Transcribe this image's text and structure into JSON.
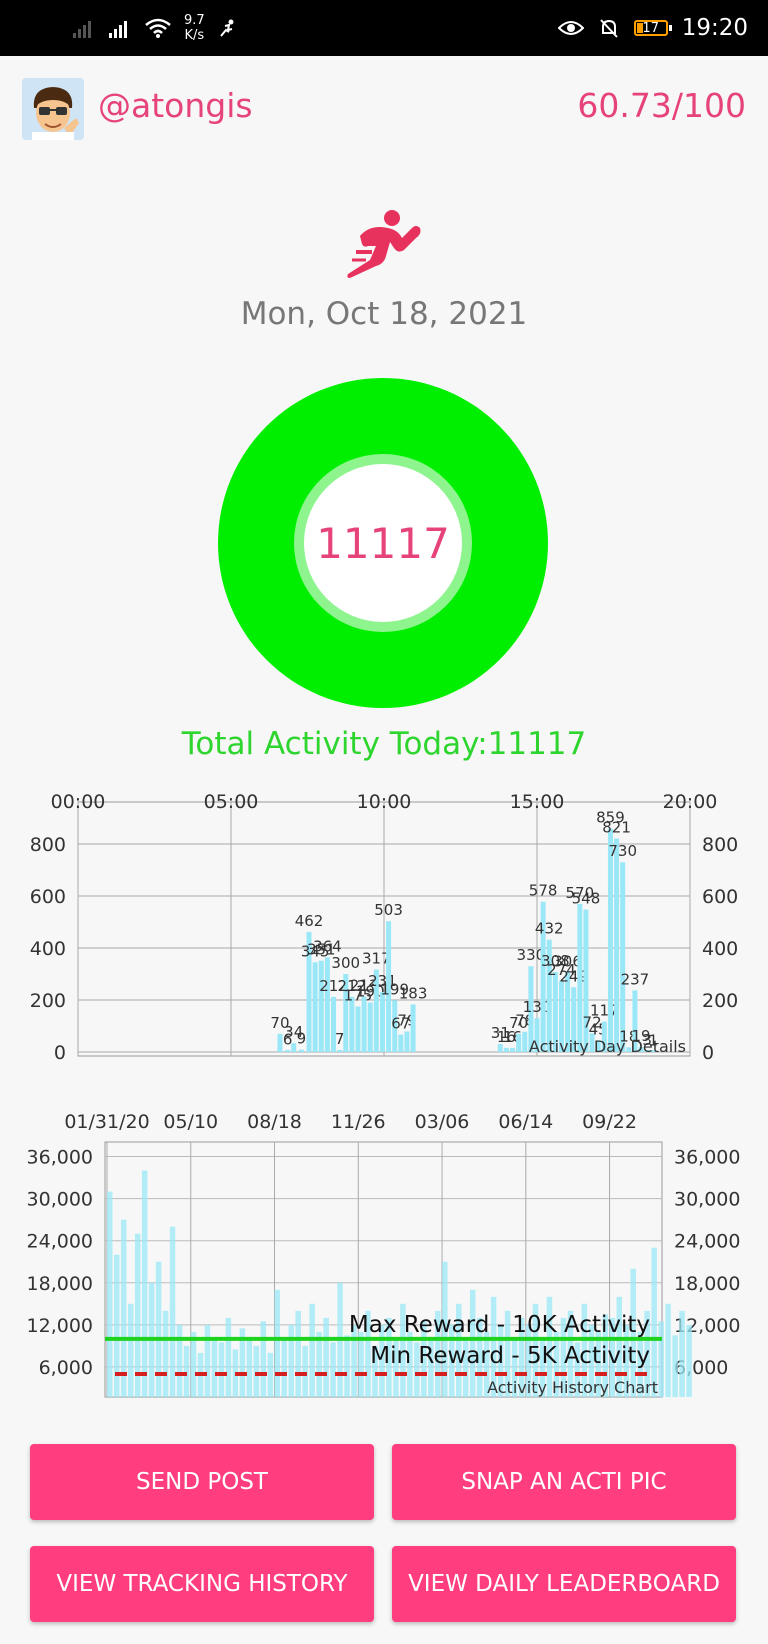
{
  "status_bar": {
    "speed_value": "9.7",
    "speed_unit": "K/s",
    "battery": "17",
    "time": "19:20"
  },
  "header": {
    "username": "@atongis",
    "score": "60.73/100"
  },
  "date": "Mon, Oct 18, 2021",
  "ring": {
    "value": "11117",
    "color": "#00ef00"
  },
  "total_activity": "Total Activity Today:11117",
  "chart_data": [
    {
      "type": "bar",
      "caption": "Activity Day Details",
      "x_ticks": [
        "00:00",
        "05:00",
        "10:00",
        "15:00",
        "20:00"
      ],
      "x_range_hours": [
        0,
        24
      ],
      "ylim": [
        0,
        900
      ],
      "y_ticks": [
        "0",
        "200",
        "400",
        "600",
        "800"
      ],
      "bar_color": "#9ae8f7",
      "bars": [
        {
          "t": 6.6,
          "v": 70,
          "label": "70"
        },
        {
          "t": 6.85,
          "v": 6,
          "label": "6"
        },
        {
          "t": 7.05,
          "v": 34,
          "label": "34"
        },
        {
          "t": 7.3,
          "v": 9,
          "label": "9"
        },
        {
          "t": 7.55,
          "v": 462,
          "label": "462"
        },
        {
          "t": 7.75,
          "v": 345,
          "label": "345"
        },
        {
          "t": 7.95,
          "v": 351,
          "label": "351"
        },
        {
          "t": 8.15,
          "v": 364,
          "label": "364"
        },
        {
          "t": 8.35,
          "v": 212,
          "label": "212"
        },
        {
          "t": 8.55,
          "v": 7,
          "label": "7"
        },
        {
          "t": 8.75,
          "v": 300,
          "label": "300"
        },
        {
          "t": 8.95,
          "v": 212,
          "label": "212"
        },
        {
          "t": 9.15,
          "v": 175,
          "label": "175"
        },
        {
          "t": 9.35,
          "v": 213,
          "label": "213"
        },
        {
          "t": 9.55,
          "v": 190,
          "label": "190"
        },
        {
          "t": 9.75,
          "v": 317,
          "label": "317"
        },
        {
          "t": 9.95,
          "v": 231,
          "label": "231"
        },
        {
          "t": 10.15,
          "v": 503,
          "label": "503"
        },
        {
          "t": 10.35,
          "v": 199,
          "label": "199"
        },
        {
          "t": 10.55,
          "v": 67,
          "label": "67"
        },
        {
          "t": 10.75,
          "v": 79,
          "label": "79"
        },
        {
          "t": 10.95,
          "v": 183,
          "label": "183"
        },
        {
          "t": 13.8,
          "v": 31,
          "label": "31"
        },
        {
          "t": 14.0,
          "v": 16,
          "label": "16"
        },
        {
          "t": 14.2,
          "v": 16,
          "label": "16"
        },
        {
          "t": 14.4,
          "v": 70,
          "label": "70"
        },
        {
          "t": 14.6,
          "v": 78,
          "label": "78"
        },
        {
          "t": 14.8,
          "v": 330,
          "label": "330"
        },
        {
          "t": 15.0,
          "v": 130,
          "label": "130"
        },
        {
          "t": 15.2,
          "v": 578,
          "label": "578"
        },
        {
          "t": 15.4,
          "v": 432,
          "label": "432"
        },
        {
          "t": 15.6,
          "v": 308,
          "label": "308"
        },
        {
          "t": 15.8,
          "v": 274,
          "label": "274"
        },
        {
          "t": 16.0,
          "v": 306,
          "label": "306"
        },
        {
          "t": 16.2,
          "v": 249,
          "label": "249"
        },
        {
          "t": 16.4,
          "v": 570,
          "label": "570"
        },
        {
          "t": 16.6,
          "v": 548,
          "label": "548"
        },
        {
          "t": 16.8,
          "v": 72,
          "label": "72"
        },
        {
          "t": 17.0,
          "v": 45,
          "label": "45"
        },
        {
          "t": 17.2,
          "v": 117,
          "label": "117"
        },
        {
          "t": 17.4,
          "v": 859,
          "label": "859"
        },
        {
          "t": 17.6,
          "v": 821,
          "label": "821"
        },
        {
          "t": 17.8,
          "v": 730,
          "label": "730"
        },
        {
          "t": 18.0,
          "v": 18,
          "label": "18"
        },
        {
          "t": 18.2,
          "v": 237,
          "label": "237"
        },
        {
          "t": 18.4,
          "v": 19,
          "label": "19"
        },
        {
          "t": 18.6,
          "v": 3,
          "label": "3"
        },
        {
          "t": 18.8,
          "v": 1,
          "label": "1"
        }
      ]
    },
    {
      "type": "bar",
      "caption": "Activity History Chart",
      "x_ticks": [
        "01/31/20",
        "05/10",
        "08/18",
        "11/26",
        "03/06",
        "06/14",
        "09/22"
      ],
      "ylim": [
        0,
        36000
      ],
      "y_ticks": [
        "6,000",
        "12,000",
        "18,000",
        "24,000",
        "30,000",
        "36,000"
      ],
      "bar_color": "#9ae8f7",
      "reference_lines": [
        {
          "label": "Max Reward - 10K Activity",
          "value": 10000,
          "color": "#1ed21e",
          "style": "solid"
        },
        {
          "label": "Min Reward - 5K Activity",
          "value": 5000,
          "color": "#d62020",
          "style": "dashed"
        }
      ],
      "segments": [
        {
          "values": [
            31000,
            22000,
            27000,
            15000,
            25000,
            34000,
            18000,
            21000,
            14000,
            26000,
            12000,
            9000
          ]
        },
        {
          "values": [
            11000,
            8000,
            12000,
            10000,
            9500,
            13000,
            8500,
            11500,
            10000,
            9000,
            12500,
            8000
          ]
        },
        {
          "values": [
            17000,
            10000,
            12000,
            14000,
            9000,
            15000,
            11000,
            13000,
            9500,
            18000,
            10500,
            12000
          ]
        },
        {
          "values": [
            11000,
            14000,
            9000,
            12000,
            13000,
            10000,
            15000,
            11000,
            9500,
            12500,
            10000,
            14000
          ]
        },
        {
          "values": [
            21000,
            12000,
            15000,
            10000,
            17000,
            13000,
            11000,
            16000,
            12000,
            14000,
            10000,
            13000
          ]
        },
        {
          "values": [
            12000,
            15000,
            10000,
            16000,
            11000,
            13000,
            14000,
            9500,
            15000,
            12000,
            11000,
            13500
          ]
        },
        {
          "values": [
            13000,
            16000,
            12000,
            20000,
            11000,
            14000,
            23000,
            12500,
            15000,
            10500,
            14000,
            12000
          ]
        }
      ]
    }
  ],
  "buttons": {
    "send_post": "SEND POST",
    "snap_pic": "SNAP AN ACTI PIC",
    "view_history": "VIEW TRACKING HISTORY",
    "view_leaderboard": "VIEW DAILY LEADERBOARD"
  }
}
